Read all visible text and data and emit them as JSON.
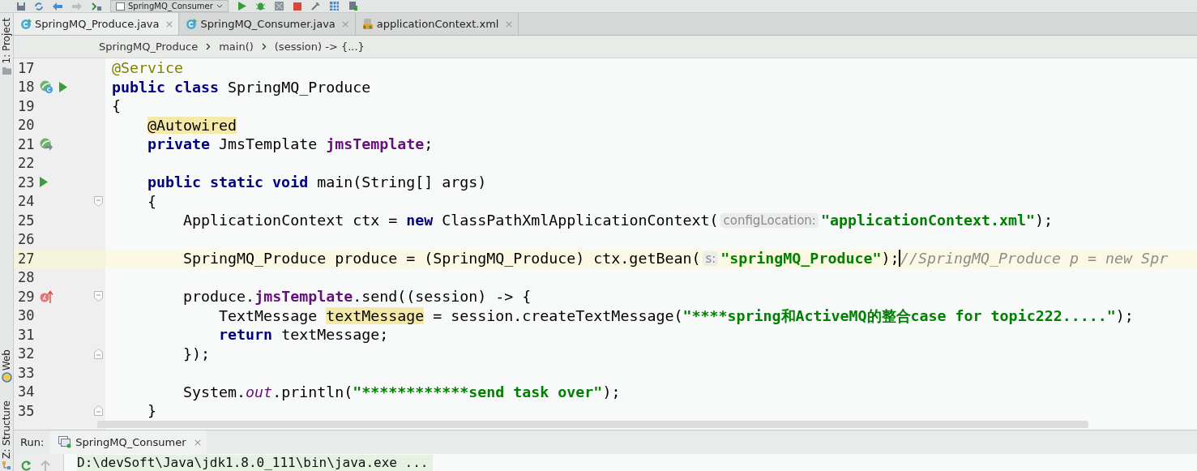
{
  "toolbar": {
    "run_config": "SpringMQ_Consumer"
  },
  "tabs": [
    {
      "label": "SpringMQ_Produce.java",
      "kind": "java",
      "selected": true,
      "close": "×"
    },
    {
      "label": "SpringMQ_Consumer.java",
      "kind": "java",
      "selected": false,
      "close": "×"
    },
    {
      "label": "applicationContext.xml",
      "kind": "xml",
      "selected": false,
      "close": "×"
    }
  ],
  "breadcrumbs": [
    "SpringMQ_Produce",
    "main()",
    "(session) -> {...}"
  ],
  "side_tool_windows": [
    {
      "label": "1: Project",
      "kind": "project"
    },
    {
      "label": "Web",
      "kind": "web"
    },
    {
      "label": "Z: Structure",
      "kind": "structure"
    }
  ],
  "editor": {
    "lines": [
      {
        "number": "17",
        "tokens": [
          {
            "kind": "annotation",
            "text": "@Service"
          }
        ]
      },
      {
        "number": "18",
        "gutter": [
          {
            "kind": "bean"
          },
          {
            "kind": "run"
          }
        ],
        "tokens": [
          {
            "kind": "keyword",
            "text": "public class "
          },
          {
            "kind": "plain",
            "text": "SpringMQ_Produce"
          }
        ]
      },
      {
        "number": "19",
        "tokens": [
          {
            "kind": "plain",
            "text": "{"
          }
        ]
      },
      {
        "number": "20",
        "tokens": [
          {
            "kind": "usage",
            "text": "    @Autowired"
          }
        ]
      },
      {
        "number": "21",
        "gutter": [
          {
            "kind": "autowire"
          }
        ],
        "tokens": [
          {
            "kind": "keyword",
            "text": "    private "
          },
          {
            "kind": "plain",
            "text": "JmsTemplate "
          },
          {
            "kind": "field",
            "text": "jmsTemplate"
          },
          {
            "kind": "plain",
            "text": ";"
          }
        ]
      },
      {
        "number": "22"
      },
      {
        "number": "23",
        "gutter": [
          {
            "kind": "run"
          }
        ],
        "tokens": [
          {
            "kind": "keyword",
            "text": "    public static void "
          },
          {
            "kind": "plain",
            "text": "main(String[] args)"
          }
        ]
      },
      {
        "number": "24",
        "fold": {
          "kind": "start"
        },
        "tokens": [
          {
            "kind": "plain",
            "text": "    {"
          }
        ]
      },
      {
        "number": "25",
        "tokens": [
          {
            "kind": "plain",
            "text": "        ApplicationContext ctx = "
          },
          {
            "kind": "keyword",
            "text": "new"
          },
          {
            "kind": "plain",
            "text": " ClassPathXmlApplicationContext("
          },
          {
            "kind": "hint",
            "text": "configLocation:"
          },
          {
            "kind": "string",
            "text": "\"applicationContext.xml\""
          },
          {
            "kind": "plain",
            "text": ");"
          }
        ]
      },
      {
        "number": "26"
      },
      {
        "number": "27",
        "current": true,
        "tokens": [
          {
            "kind": "plain",
            "text": "        SpringMQ_Produce produce = (SpringMQ_Produce) ctx.getBean("
          },
          {
            "kind": "hint",
            "text": "s:"
          },
          {
            "kind": "string",
            "text": "\"springMQ_Produce\""
          },
          {
            "kind": "plain",
            "text": ");"
          },
          {
            "kind": "comment",
            "text": "//SpringMQ_Produce p = new Spr",
            "caret_before": true
          }
        ]
      },
      {
        "number": "28"
      },
      {
        "number": "29",
        "gutter": [
          {
            "kind": "lambda"
          }
        ],
        "fold": {
          "kind": "start"
        },
        "tokens": [
          {
            "kind": "plain",
            "text": "        produce."
          },
          {
            "kind": "field",
            "text": "jmsTemplate"
          },
          {
            "kind": "plain",
            "text": ".send((session) -> {"
          }
        ]
      },
      {
        "number": "30",
        "tokens": [
          {
            "kind": "plain",
            "text": "            TextMessage "
          },
          {
            "kind": "usage",
            "text": "textMessage"
          },
          {
            "kind": "plain",
            "text": " = session.createTextMessage("
          },
          {
            "kind": "string",
            "text": "\"****spring和ActiveMQ的整合case for topic222.....\""
          },
          {
            "kind": "plain",
            "text": ");"
          }
        ]
      },
      {
        "number": "31",
        "tokens": [
          {
            "kind": "keyword",
            "text": "            return"
          },
          {
            "kind": "plain",
            "text": " textMessage;"
          }
        ]
      },
      {
        "number": "32",
        "fold": {
          "kind": "end"
        },
        "tokens": [
          {
            "kind": "plain",
            "text": "        });"
          }
        ]
      },
      {
        "number": "33"
      },
      {
        "number": "34",
        "tokens": [
          {
            "kind": "plain",
            "text": "        System."
          },
          {
            "kind": "static",
            "text": "out"
          },
          {
            "kind": "plain",
            "text": ".println("
          },
          {
            "kind": "string",
            "text": "\"************send task over\""
          },
          {
            "kind": "plain",
            "text": ");"
          }
        ]
      },
      {
        "number": "35",
        "fold": {
          "kind": "end"
        },
        "tokens": [
          {
            "kind": "plain",
            "text": "    }"
          }
        ]
      }
    ]
  },
  "run_panel": {
    "label": "Run:",
    "tab": {
      "label": "SpringMQ_Consumer",
      "close": "×"
    },
    "console_line": "D:\\devSoft\\Java\\jdk1.8.0_111\\bin\\java.exe ..."
  }
}
